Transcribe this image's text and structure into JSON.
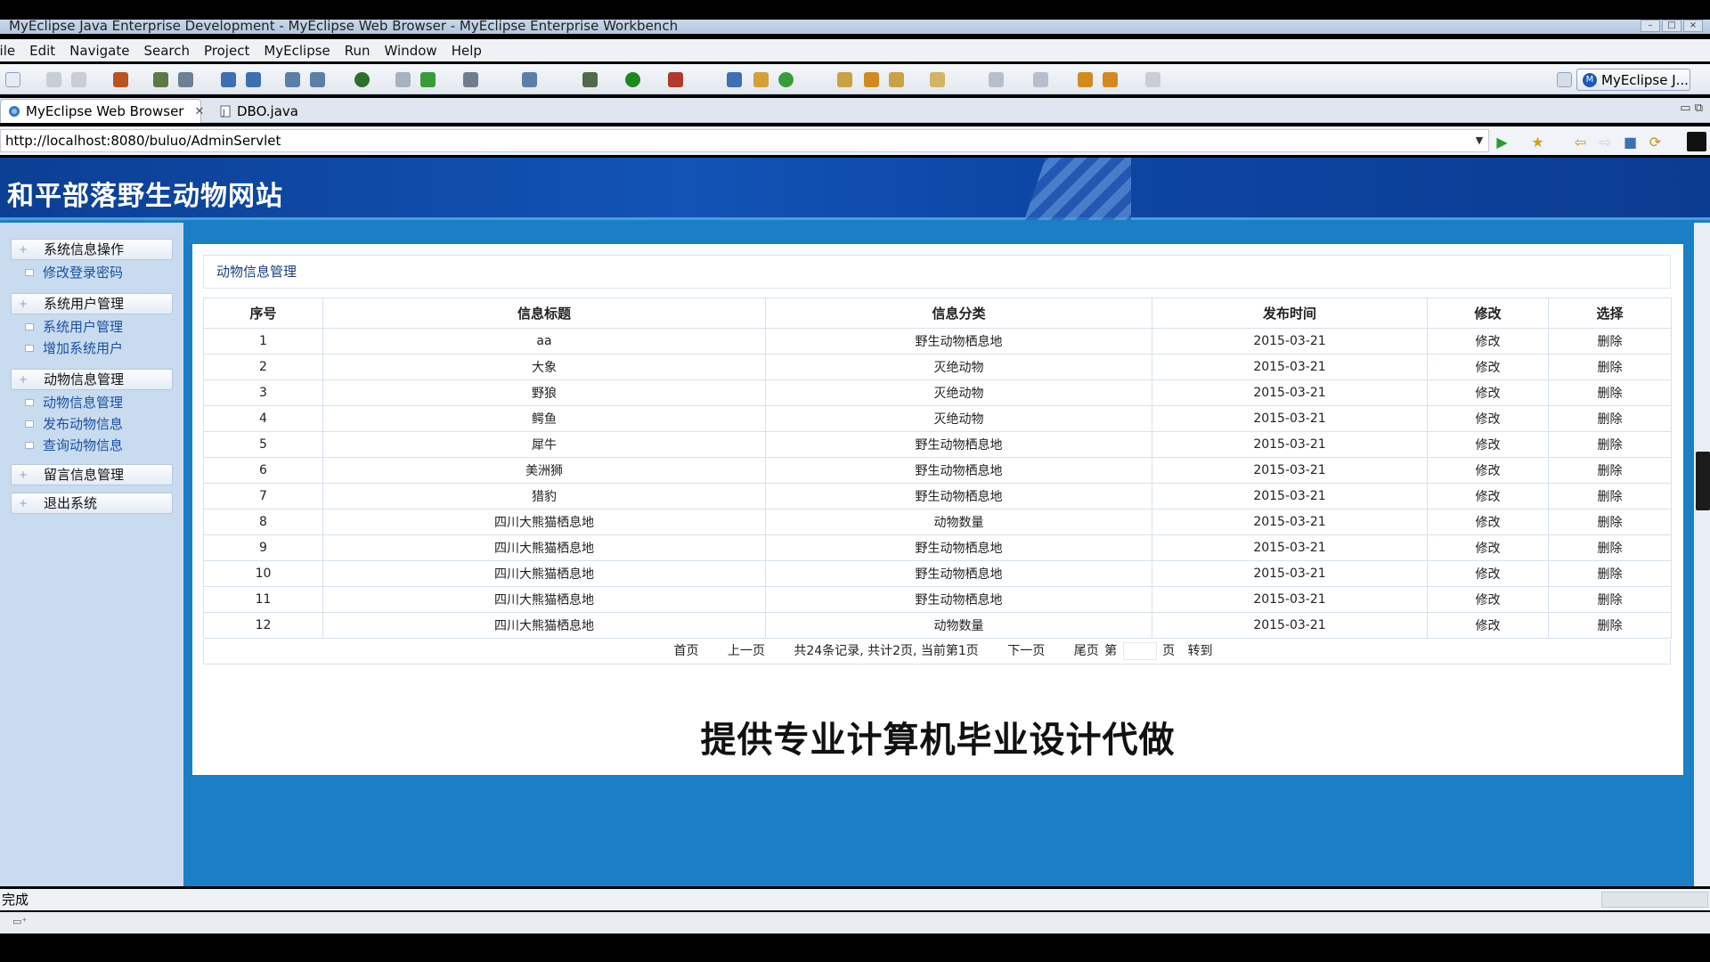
{
  "window": {
    "title": "MyEclipse Java Enterprise Development - MyEclipse Web Browser - MyEclipse Enterprise Workbench"
  },
  "menu": [
    "File",
    "Edit",
    "Navigate",
    "Search",
    "Project",
    "MyEclipse",
    "Run",
    "Window",
    "Help"
  ],
  "perspective": {
    "label": "MyEclipse J..."
  },
  "tabs": [
    {
      "label": "MyEclipse Web Browser",
      "active": true
    },
    {
      "label": "DBO.java",
      "active": false
    }
  ],
  "browser": {
    "url": "http://localhost:8080/buluo/AdminServlet"
  },
  "site": {
    "title": "和平部落野生动物网站"
  },
  "sidebar": {
    "groups": [
      {
        "label": "系统信息操作",
        "items": [
          "修改登录密码"
        ]
      },
      {
        "label": "系统用户管理",
        "items": [
          "系统用户管理",
          "增加系统用户"
        ]
      },
      {
        "label": "动物信息管理",
        "items": [
          "动物信息管理",
          "发布动物信息",
          "查询动物信息"
        ]
      },
      {
        "label": "留言信息管理",
        "items": []
      },
      {
        "label": "退出系统",
        "items": []
      }
    ]
  },
  "main": {
    "panel_title": "动物信息管理",
    "columns": [
      "序号",
      "信息标题",
      "信息分类",
      "发布时间",
      "修改",
      "选择"
    ],
    "rows": [
      [
        "1",
        "aa",
        "野生动物栖息地",
        "2015-03-21",
        "修改",
        "删除"
      ],
      [
        "2",
        "大象",
        "灭绝动物",
        "2015-03-21",
        "修改",
        "删除"
      ],
      [
        "3",
        "野狼",
        "灭绝动物",
        "2015-03-21",
        "修改",
        "删除"
      ],
      [
        "4",
        "鳄鱼",
        "灭绝动物",
        "2015-03-21",
        "修改",
        "删除"
      ],
      [
        "5",
        "犀牛",
        "野生动物栖息地",
        "2015-03-21",
        "修改",
        "删除"
      ],
      [
        "6",
        "美洲狮",
        "野生动物栖息地",
        "2015-03-21",
        "修改",
        "删除"
      ],
      [
        "7",
        "猎豹",
        "野生动物栖息地",
        "2015-03-21",
        "修改",
        "删除"
      ],
      [
        "8",
        "四川大熊猫栖息地",
        "动物数量",
        "2015-03-21",
        "修改",
        "删除"
      ],
      [
        "9",
        "四川大熊猫栖息地",
        "野生动物栖息地",
        "2015-03-21",
        "修改",
        "删除"
      ],
      [
        "10",
        "四川大熊猫栖息地",
        "野生动物栖息地",
        "2015-03-21",
        "修改",
        "删除"
      ],
      [
        "11",
        "四川大熊猫栖息地",
        "野生动物栖息地",
        "2015-03-21",
        "修改",
        "删除"
      ],
      [
        "12",
        "四川大熊猫栖息地",
        "动物数量",
        "2015-03-21",
        "修改",
        "删除"
      ]
    ],
    "pager": {
      "first": "首页",
      "prev": "上一页",
      "summary": "共24条记录, 共计2页, 当前第1页",
      "next": "下一页",
      "last": "尾页",
      "page_prefix": "第",
      "page_suffix": "页",
      "go": "转到"
    }
  },
  "overlay_caption": "提供专业计算机毕业设计代做",
  "status": {
    "text": "完成"
  },
  "colors": {
    "header": "#0d47a5",
    "content_bg": "#1a7fc4",
    "sidebar_bg": "#c9dcef",
    "link": "#1b4fa0"
  }
}
